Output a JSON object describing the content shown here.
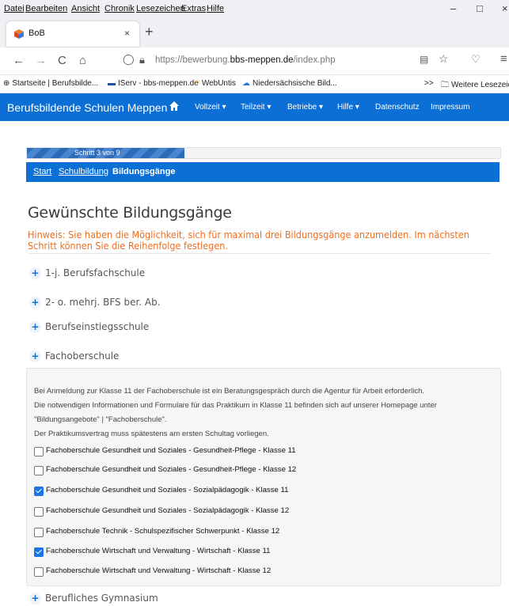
{
  "menubar": {
    "items": [
      "Datei",
      "Bearbeiten",
      "Ansicht",
      "Chronik",
      "Lesezeichen",
      "Extras",
      "Hilfe"
    ],
    "controls": [
      "–",
      "□",
      "×"
    ]
  },
  "tab": {
    "title": "BoB",
    "close": "×",
    "newtab": "+"
  },
  "nav": {
    "back": "←",
    "forward": "→",
    "reload": "C",
    "home": "⌂",
    "url_prefix": "https://bewerbung.",
    "url_domain": "bbs-meppen.de",
    "url_path": "/index.php"
  },
  "bookmarks": {
    "items": [
      "Startseite | Berufsbilde...",
      "IServ - bbs-meppen.de",
      "WebUntis",
      "Niedersächsische Bild..."
    ],
    "overflow": ">>",
    "more": "Weitere Lesezeichen"
  },
  "site": {
    "brand": "Berufsbildende Schulen Meppen",
    "menu": [
      "Vollzeit",
      "Teilzeit",
      "Betriebe",
      "Hilfe",
      "Datenschutz",
      "Impressum"
    ],
    "accent": "#0b6fd6"
  },
  "progress": {
    "label": "Schritt 3 von 9",
    "value": 0.333
  },
  "breadcrumb": {
    "start": "Start",
    "schulbildung": "Schulbildung",
    "current": "Bildungsgänge"
  },
  "page": {
    "title": "Gewünschte Bildungsgänge",
    "hint": "Hinweis: Sie haben die Möglichkeit, sich für maximal drei Bildungsgänge anzumelden. Im nächsten Schritt können Sie die Reihenfolge festlegen."
  },
  "sections": [
    {
      "label": "1-j. Berufsfachschule"
    },
    {
      "label": "2- o. mehrj. BFS ber. Ab."
    },
    {
      "label": "Berufseinstiegsschule"
    },
    {
      "label": "Fachoberschule"
    }
  ],
  "fachoberschule": {
    "info": [
      "Bei Anmeldung zur Klasse 11 der Fachoberschule ist ein Beratungsgespräch durch die Agentur für Arbeit erforderlich.",
      "Die notwendigen Informationen und Formulare für das Praktikum in Klasse 11 befinden sich auf unserer Homepage unter",
      "\"Bildungsangebote\" | \"Fachoberschule\".",
      "Der Praktikumsvertrag muss spätestens am ersten Schultag vorliegen."
    ],
    "options": [
      {
        "label": "Fachoberschule Gesundheit und Soziales - Gesundheit-Pflege - Klasse 11",
        "checked": false
      },
      {
        "label": "Fachoberschule Gesundheit und Soziales - Gesundheit-Pflege - Klasse 12",
        "checked": false
      },
      {
        "label": "Fachoberschule Gesundheit und Soziales - Sozialpädagogik - Klasse 11",
        "checked": true
      },
      {
        "label": "Fachoberschule Gesundheit und Soziales - Sozialpädagogik - Klasse 12",
        "checked": false
      },
      {
        "label": "Fachoberschule Technik - Schulspezifischer Schwerpunkt - Klasse 12",
        "checked": false
      },
      {
        "label": "Fachoberschule Wirtschaft und Verwaltung - Wirtschaft - Klasse 11",
        "checked": true
      },
      {
        "label": "Fachoberschule Wirtschaft und Verwaltung - Wirtschaft - Klasse 12",
        "checked": false
      }
    ]
  },
  "next_section": {
    "label": "Berufliches Gymnasium"
  }
}
